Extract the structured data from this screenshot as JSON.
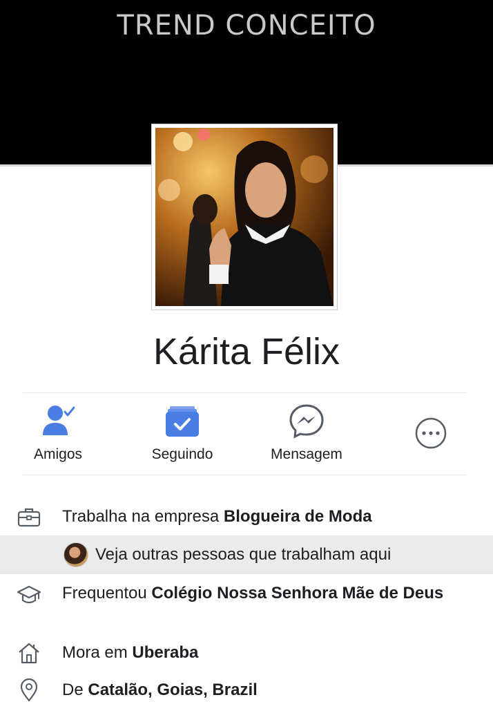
{
  "cover": {
    "title": "TREND CONCEITO"
  },
  "profile": {
    "name": "Kárita Félix"
  },
  "actions": [
    {
      "label": "Amigos",
      "icon": "friends-icon"
    },
    {
      "label": "Seguindo",
      "icon": "following-icon"
    },
    {
      "label": "Mensagem",
      "icon": "messenger-icon"
    },
    {
      "label": "",
      "icon": "more-icon"
    }
  ],
  "about": {
    "work": {
      "prefix": "Trabalha na empresa ",
      "value": "Blogueira de Moda",
      "icon": "briefcase-icon"
    },
    "coworkers": {
      "text": "Veja outras pessoas que trabalham aqui"
    },
    "education": {
      "prefix": "Frequentou ",
      "value": "Colégio Nossa Senhora Mãe de Deus",
      "icon": "graduation-cap-icon"
    },
    "home": {
      "prefix": "Mora em ",
      "value": "Uberaba",
      "icon": "house-icon"
    },
    "origin": {
      "prefix": "De ",
      "value": "Catalão, Goias, Brazil",
      "icon": "location-pin-icon"
    }
  },
  "colors": {
    "accent": "#4a7ee3",
    "icon_gray": "#555c66",
    "highlight_row": "#ebebeb",
    "cover": "#000000"
  }
}
